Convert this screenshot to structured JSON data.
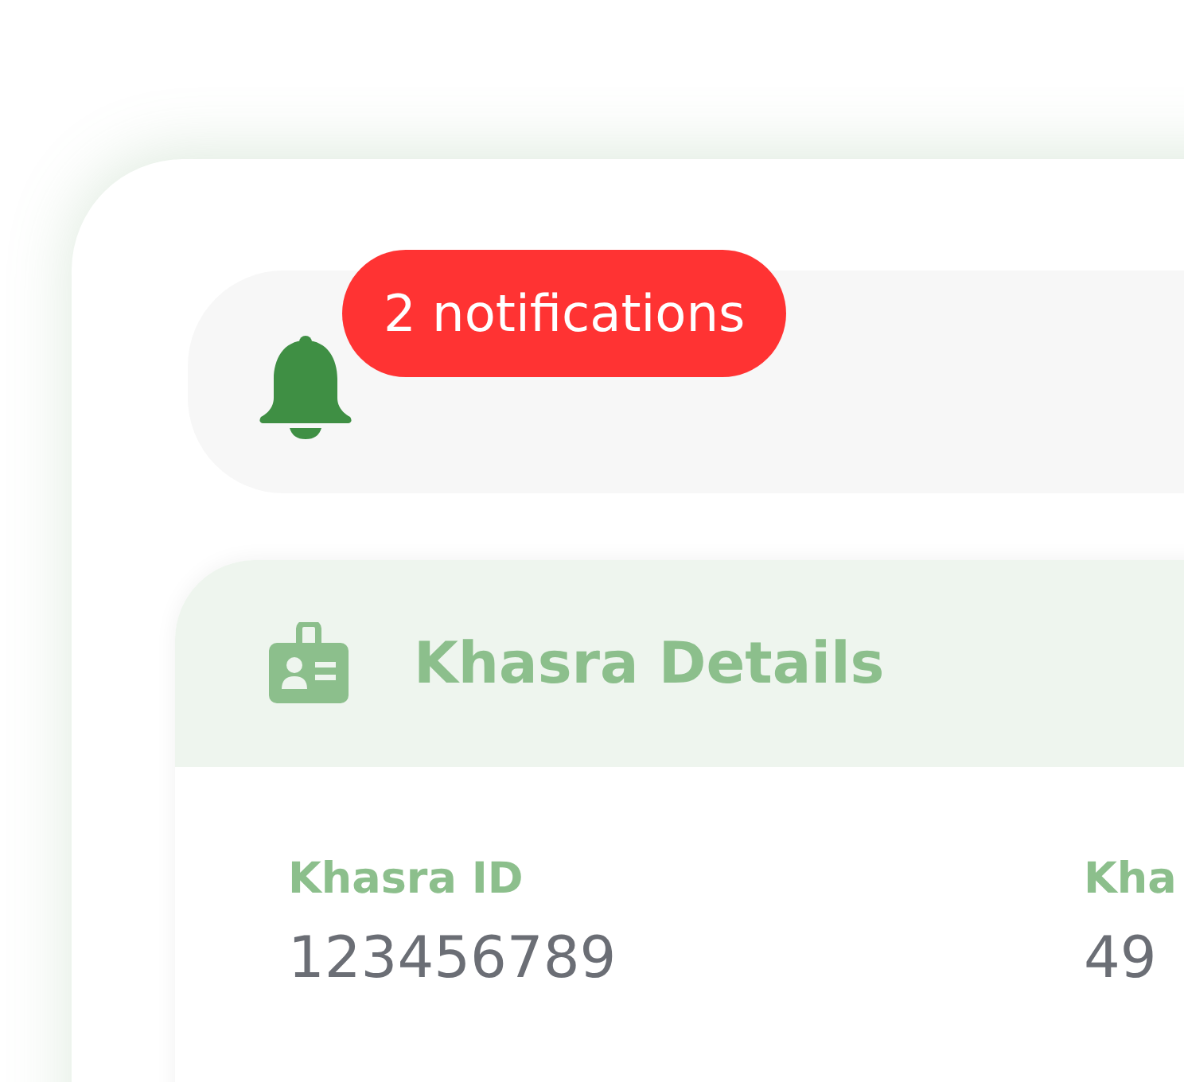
{
  "notifications": {
    "badge": "2 notifications"
  },
  "khasra_details": {
    "title": "Khasra Details",
    "fields": [
      {
        "label": "Khasra ID",
        "value": "123456789"
      },
      {
        "label": "Kha",
        "value": "49"
      }
    ]
  }
}
